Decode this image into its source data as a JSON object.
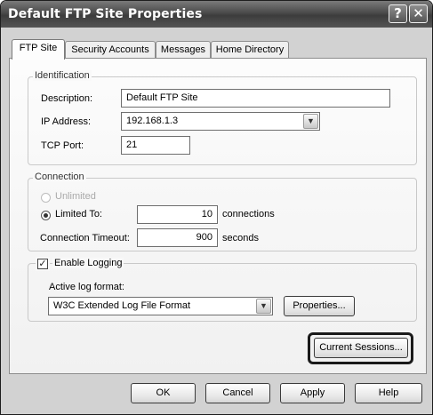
{
  "window": {
    "title": "Default FTP Site Properties",
    "help_glyph": "?",
    "close_glyph": "✕"
  },
  "tabs": [
    {
      "label": "FTP Site",
      "active": true
    },
    {
      "label": "Security Accounts",
      "active": false
    },
    {
      "label": "Messages",
      "active": false
    },
    {
      "label": "Home Directory",
      "active": false
    }
  ],
  "identification": {
    "legend": "Identification",
    "description_label": "Description:",
    "description_value": "Default FTP Site",
    "ip_label": "IP Address:",
    "ip_value": "192.168.1.3",
    "port_label": "TCP Port:",
    "port_value": "21"
  },
  "connection": {
    "legend": "Connection",
    "unlimited_label": "Unlimited",
    "limited_label": "Limited To:",
    "limited_value": "10",
    "limited_unit": "connections",
    "timeout_label": "Connection Timeout:",
    "timeout_value": "900",
    "timeout_unit": "seconds"
  },
  "logging": {
    "enable_label": "Enable Logging",
    "enabled": true,
    "format_label": "Active log format:",
    "format_value": "W3C Extended Log File Format",
    "properties_button": "Properties..."
  },
  "current_sessions_button": "Current Sessions...",
  "footer": {
    "ok": "OK",
    "cancel": "Cancel",
    "apply": "Apply",
    "help": "Help"
  },
  "icons": {
    "dropdown_arrow": "▼",
    "check_mark": "✓"
  }
}
